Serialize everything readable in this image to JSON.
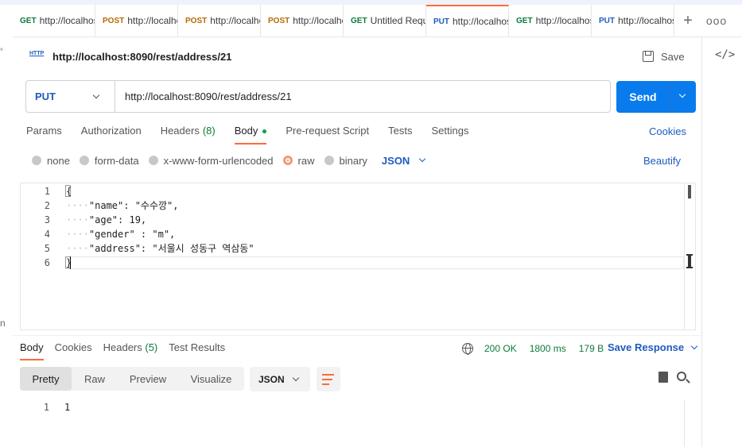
{
  "tabs": [
    {
      "method": "GET",
      "url": "http://localhost",
      "active": false
    },
    {
      "method": "POST",
      "url": "http://localhost",
      "active": false
    },
    {
      "method": "POST",
      "url": "http://localhost",
      "active": false
    },
    {
      "method": "POST",
      "url": "http://localhost",
      "active": false
    },
    {
      "method": "GET",
      "url": "Untitled Request",
      "active": false
    },
    {
      "method": "PUT",
      "url": "http://localhost",
      "active": true
    },
    {
      "method": "GET",
      "url": "http://localhost",
      "active": false
    },
    {
      "method": "PUT",
      "url": "http://localhost",
      "active": false
    }
  ],
  "tab_actions": {
    "new": "+",
    "more": "ooo"
  },
  "edge": {
    "top": "°",
    "bottom": "n"
  },
  "request": {
    "http_badge": "HTTP",
    "title": "http://localhost:8090/rest/address/21",
    "save_label": "Save",
    "method": "PUT",
    "url": "http://localhost:8090/rest/address/21",
    "send_label": "Send"
  },
  "request_tabs": {
    "params": "Params",
    "authorization": "Authorization",
    "headers": "Headers",
    "headers_count": "(8)",
    "body": "Body",
    "prerequest": "Pre-request Script",
    "tests": "Tests",
    "settings": "Settings",
    "cookies": "Cookies"
  },
  "body_types": {
    "none": "none",
    "form_data": "form-data",
    "urlencoded": "x-www-form-urlencoded",
    "raw": "raw",
    "binary": "binary",
    "selected": "raw",
    "language": "JSON",
    "beautify": "Beautify"
  },
  "editor": {
    "line_numbers": [
      "1",
      "2",
      "3",
      "4",
      "5",
      "6"
    ],
    "lines": [
      {
        "indent": "",
        "text": "{"
      },
      {
        "indent": "····",
        "text": "\"name\": \"수수깡\","
      },
      {
        "indent": "····",
        "text": "\"age\": 19,"
      },
      {
        "indent": "····",
        "text": "\"gender\" : \"m\","
      },
      {
        "indent": "····",
        "text": "\"address\": \"서울시 성동구 역삼동\""
      },
      {
        "indent": "",
        "text": "}"
      }
    ]
  },
  "response_tabs": {
    "body": "Body",
    "cookies": "Cookies",
    "headers": "Headers",
    "headers_count": "(5)",
    "test_results": "Test Results"
  },
  "response_meta": {
    "status": "200 OK",
    "time": "1800 ms",
    "size": "179 B",
    "save_response": "Save Response"
  },
  "response_format": {
    "options": [
      "Pretty",
      "Raw",
      "Preview",
      "Visualize"
    ],
    "selected": "Pretty",
    "language": "JSON"
  },
  "response_body": {
    "line_numbers": [
      "1"
    ],
    "lines": [
      "1"
    ]
  },
  "colors": {
    "accent": "#ff6c37",
    "send": "#097bed",
    "link": "#1d5bbf",
    "status_ok": "#0b7a39"
  }
}
